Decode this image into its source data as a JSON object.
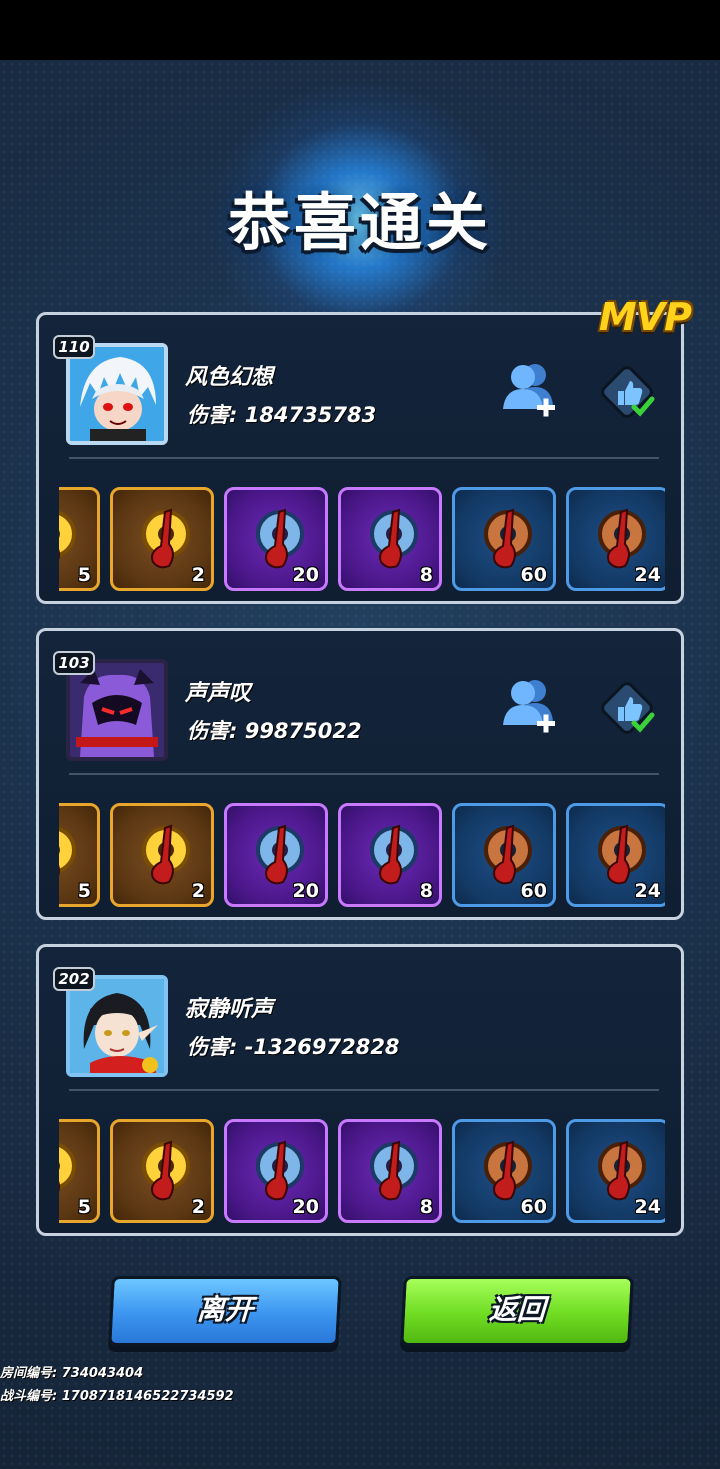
{
  "title": "恭喜通关",
  "mvp_label": "MVP",
  "players": [
    {
      "level": "110",
      "name": "风色幻想",
      "damage": "伤害: 184735783",
      "avatar_icon": "white-haired-hero-avatar",
      "mvp": true
    },
    {
      "level": "103",
      "name": "声声叹",
      "damage": "伤害: 99875022",
      "avatar_icon": "purple-demon-avatar",
      "mvp": false
    },
    {
      "level": "202",
      "name": "寂静听声",
      "damage": "伤害: -1326972828",
      "avatar_icon": "elf-girl-avatar",
      "mvp": false
    }
  ],
  "rewards": [
    {
      "rarity": "gold",
      "qty": "5"
    },
    {
      "rarity": "gold",
      "qty": "2"
    },
    {
      "rarity": "purple",
      "qty": "20"
    },
    {
      "rarity": "purple",
      "qty": "8"
    },
    {
      "rarity": "blue",
      "qty": "60"
    },
    {
      "rarity": "blue",
      "qty": "24"
    }
  ],
  "buttons": {
    "leave": "离开",
    "back": "返回"
  },
  "room_id": "房间编号: 734043404",
  "battle_id": "战斗编号: 1708718146522734592",
  "colors": {
    "gold_border": "#e8a62c",
    "purple_border": "#c879ff",
    "blue_border": "#4d9ae6",
    "mvp": "#ffd21c",
    "leave_button": "#3c95f0",
    "back_button": "#6fdc22"
  }
}
